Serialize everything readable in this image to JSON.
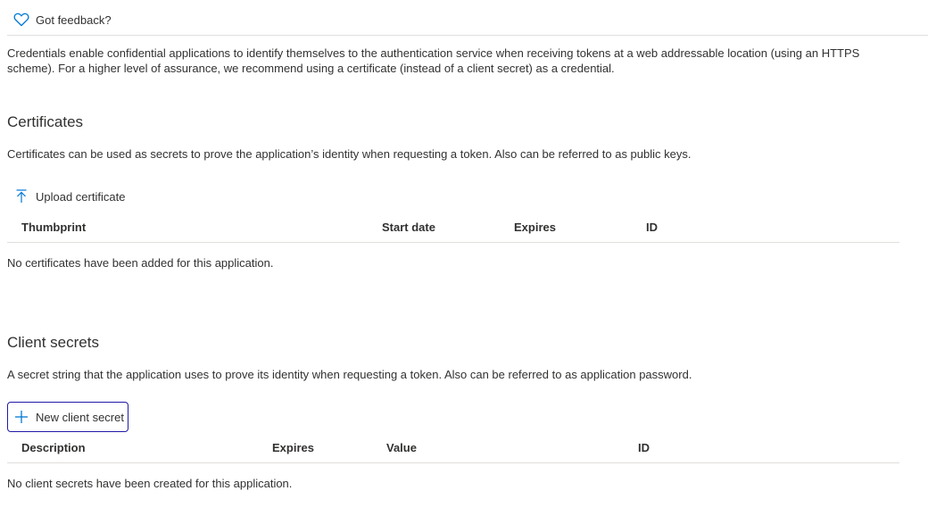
{
  "feedback": {
    "label": "Got feedback?",
    "icon": "heart-icon",
    "accent": "#0078d4"
  },
  "intro": "Credentials enable confidential applications to identify themselves to the authentication service when receiving tokens at a web addressable location (using an HTTPS scheme). For a higher level of assurance, we recommend using a certificate (instead of a client secret) as a credential.",
  "certificates": {
    "title": "Certificates",
    "description": "Certificates can be used as secrets to prove the application’s identity when requesting a token. Also can be referred to as public keys.",
    "upload_label": "Upload certificate",
    "upload_icon": "upload-icon",
    "columns": [
      "Thumbprint",
      "Start date",
      "Expires",
      "ID"
    ],
    "empty": "No certificates have been added for this application."
  },
  "client_secrets": {
    "title": "Client secrets",
    "description": "A secret string that the application uses to prove its identity when requesting a token. Also can be referred to as application password.",
    "new_label": "New client secret",
    "new_icon": "plus-icon",
    "columns": [
      "Description",
      "Expires",
      "Value",
      "ID"
    ],
    "empty": "No client secrets have been created for this application."
  }
}
